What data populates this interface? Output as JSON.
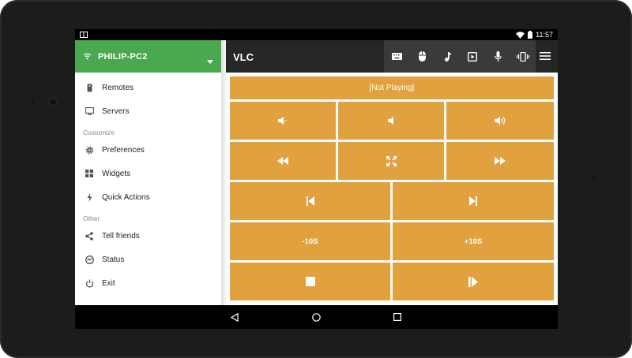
{
  "status_bar": {
    "time": "11:57",
    "icons": [
      "notification-icon",
      "wifi-icon",
      "battery-icon"
    ]
  },
  "sidebar": {
    "connection": {
      "name": "PHILIP-PC2",
      "icon": "wifi-icon",
      "accent": "#4aa84f"
    },
    "main_items": [
      {
        "label": "Remotes",
        "icon": "remote-icon"
      },
      {
        "label": "Servers",
        "icon": "monitor-icon"
      }
    ],
    "customize_header": "Customize",
    "customize_items": [
      {
        "label": "Preferences",
        "icon": "gear-icon"
      },
      {
        "label": "Widgets",
        "icon": "grid-icon"
      },
      {
        "label": "Quick Actions",
        "icon": "bolt-icon"
      }
    ],
    "other_header": "Other",
    "other_items": [
      {
        "label": "Tell friends",
        "icon": "share-icon"
      },
      {
        "label": "Status",
        "icon": "status-icon"
      },
      {
        "label": "Exit",
        "icon": "power-icon"
      }
    ]
  },
  "topbar": {
    "title": "VLC",
    "tools": [
      "keyboard-icon",
      "mouse-icon",
      "music-icon",
      "play-box-icon",
      "microphone-icon",
      "vibrate-icon",
      "menu-icon"
    ]
  },
  "remote": {
    "accent": "#e0a13e",
    "status": "[Not Playing]",
    "volume": [
      "volume-mute-icon",
      "volume-down-icon",
      "volume-up-icon"
    ],
    "seek": [
      "rewind-icon",
      "fullscreen-icon",
      "fast-forward-icon"
    ],
    "track": [
      "previous-icon",
      "next-icon"
    ],
    "jump_back": "-10S",
    "jump_forward": "+10S",
    "playback": [
      "stop-icon",
      "play-pause-icon"
    ]
  },
  "navbar": [
    "back-icon",
    "home-icon",
    "recents-icon"
  ]
}
